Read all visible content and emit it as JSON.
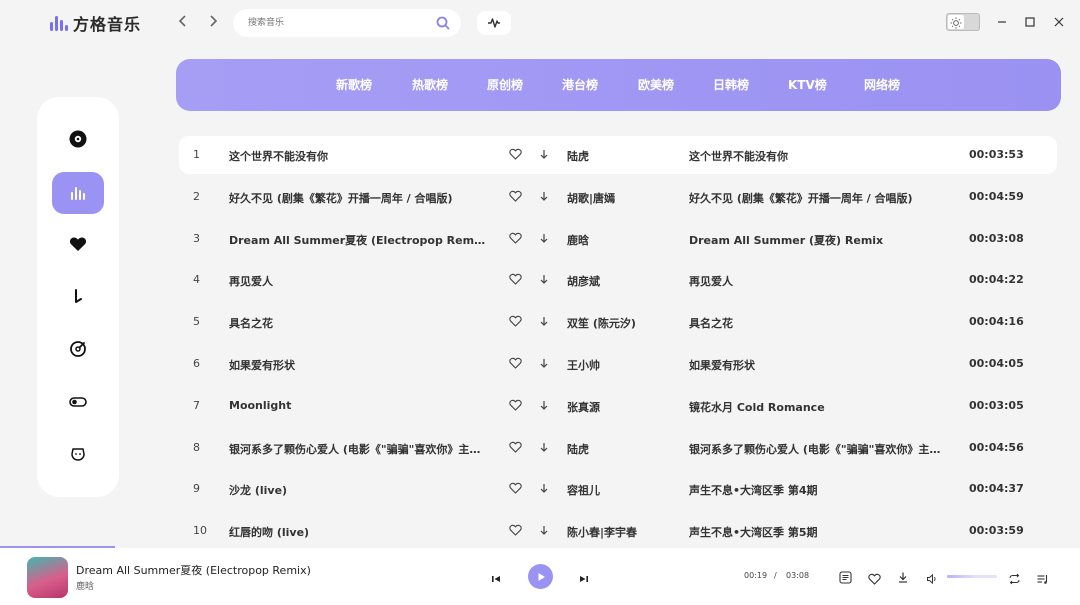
{
  "app": {
    "title": "方格音乐"
  },
  "search": {
    "placeholder": "搜索音乐"
  },
  "tabs": [
    "新歌榜",
    "热歌榜",
    "原创榜",
    "港台榜",
    "欧美榜",
    "日韩榜",
    "KTV榜",
    "网络榜"
  ],
  "sidebar": {
    "items": [
      {
        "icon": "disc-icon"
      },
      {
        "icon": "chart-bars-icon",
        "active": true
      },
      {
        "icon": "heart-icon"
      },
      {
        "icon": "download-icon"
      },
      {
        "icon": "radar-icon"
      },
      {
        "icon": "toggle-icon"
      },
      {
        "icon": "face-icon"
      }
    ]
  },
  "songs": [
    {
      "num": "1",
      "title": "这个世界不能没有你",
      "artist": "陆虎",
      "album": "这个世界不能没有你",
      "duration": "00:03:53"
    },
    {
      "num": "2",
      "title": "好久不见 (剧集《繁花》开播一周年 / 合唱版)",
      "artist": "胡歌|唐嫣",
      "album": "好久不见 (剧集《繁花》开播一周年 / 合唱版)",
      "duration": "00:04:59"
    },
    {
      "num": "3",
      "title": "Dream All Summer夏夜 (Electropop Remix)",
      "artist": "鹿晗",
      "album": "Dream All Summer (夏夜) Remix",
      "duration": "00:03:08"
    },
    {
      "num": "4",
      "title": "再见爱人",
      "artist": "胡彦斌",
      "album": "再见爱人",
      "duration": "00:04:22"
    },
    {
      "num": "5",
      "title": "具名之花",
      "artist": "双笙 (陈元汐)",
      "album": "具名之花",
      "duration": "00:04:16"
    },
    {
      "num": "6",
      "title": "如果爱有形状",
      "artist": "王小帅",
      "album": "如果爱有形状",
      "duration": "00:04:05"
    },
    {
      "num": "7",
      "title": "Moonlight",
      "artist": "张真源",
      "album": "镜花水月 Cold Romance",
      "duration": "00:03:05"
    },
    {
      "num": "8",
      "title": "银河系多了颗伤心爱人 (电影《\"骗骗\"喜欢你》主题曲)",
      "artist": "陆虎",
      "album": "银河系多了颗伤心爱人 (电影《\"骗骗\"喜欢你》主题曲)",
      "duration": "00:04:56"
    },
    {
      "num": "9",
      "title": "沙龙 (live)",
      "artist": "容祖儿",
      "album": "声生不息•大湾区季 第4期",
      "duration": "00:04:37"
    },
    {
      "num": "10",
      "title": "红唇的吻 (live)",
      "artist": "陈小春|李宇春",
      "album": "声生不息•大湾区季 第5期",
      "duration": "00:03:59"
    }
  ],
  "player": {
    "title": "Dream All Summer夏夜 (Electropop Remix)",
    "artist": "鹿晗",
    "current_time": "00:19",
    "separator": "/",
    "total_time": "03:08",
    "progress": 0.1,
    "volume": 0.6
  },
  "colors": {
    "accent": "#9b93f3",
    "banner": "#a69ef5",
    "background": "#f4f4f5"
  }
}
